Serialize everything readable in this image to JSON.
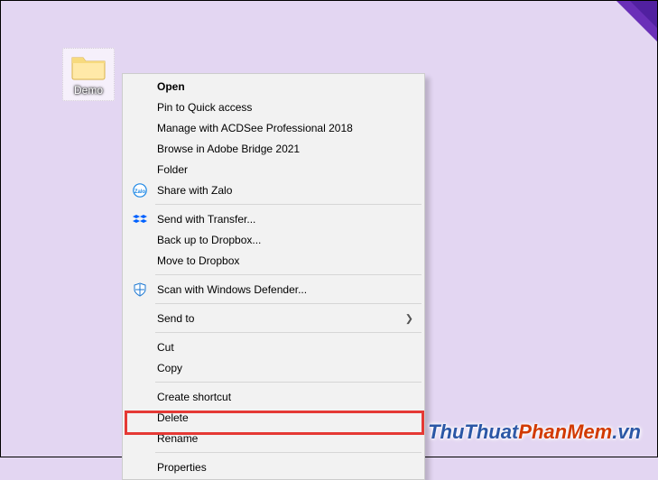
{
  "desktop": {
    "folder_label": "Demo"
  },
  "menu": {
    "open": "Open",
    "pin": "Pin to Quick access",
    "acdsee": "Manage with ACDSee Professional 2018",
    "bridge": "Browse in Adobe Bridge 2021",
    "folder": "Folder",
    "zalo": "Share with Zalo",
    "dropbox_send": "Send with Transfer...",
    "dropbox_backup": "Back up to Dropbox...",
    "dropbox_move": "Move to Dropbox",
    "defender": "Scan with Windows Defender...",
    "sendto": "Send to",
    "cut": "Cut",
    "copy": "Copy",
    "shortcut": "Create shortcut",
    "delete": "Delete",
    "rename": "Rename",
    "properties": "Properties"
  },
  "watermark": {
    "part1": "ThuThuat",
    "part2": "PhanMem",
    "part3": ".vn"
  }
}
